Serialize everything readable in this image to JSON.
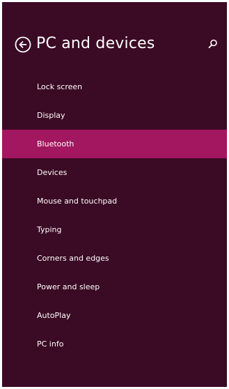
{
  "header": {
    "title": "PC and devices",
    "back_icon": "back-arrow-circle-icon",
    "search_icon": "search-icon"
  },
  "colors": {
    "background": "#3b0a24",
    "selected": "#a2175f",
    "text": "#ffffff"
  },
  "nav": {
    "selected_index": 2,
    "items": [
      {
        "label": "Lock screen"
      },
      {
        "label": "Display"
      },
      {
        "label": "Bluetooth"
      },
      {
        "label": "Devices"
      },
      {
        "label": "Mouse and touchpad"
      },
      {
        "label": "Typing"
      },
      {
        "label": "Corners and edges"
      },
      {
        "label": "Power and sleep"
      },
      {
        "label": "AutoPlay"
      },
      {
        "label": "PC info"
      }
    ]
  }
}
